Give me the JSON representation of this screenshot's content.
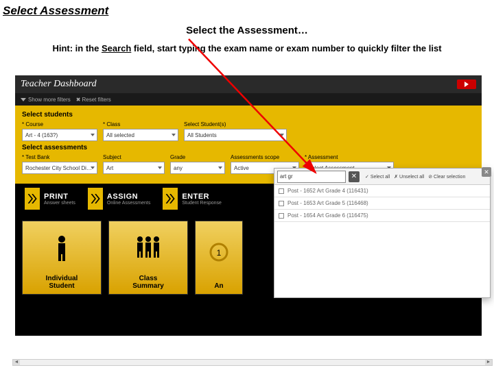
{
  "doc": {
    "title": "Select Assessment",
    "subtitle": "Select the Assessment…",
    "hint_pre": "Hint: in the ",
    "hint_hl": "Search",
    "hint_post": " field, start typing the exam name or exam number to quickly filter the list"
  },
  "app": {
    "title": "Teacher Dashboard",
    "filters": {
      "show": "Show more filters",
      "reset": "Reset filters"
    }
  },
  "students": {
    "section": "Select students",
    "course_label": "* Course",
    "course_value": "Art - 4 (163?)",
    "class_label": "* Class",
    "class_value": "All selected",
    "sel_label": "Select Student(s)",
    "sel_value": "All Students"
  },
  "assess": {
    "section": "Select assessments",
    "bank_label": "* Test Bank",
    "bank_value": "Rochester City School Di…",
    "subject_label": "Subject",
    "subject_value": "Art",
    "grade_label": "Grade",
    "grade_value": "any",
    "scope_label": "Assessments scope",
    "scope_value": "Active",
    "asmt_label": "* Assessment",
    "asmt_value": "Select Assessment"
  },
  "actions": {
    "print_t": "PRINT",
    "print_s": "Answer sheets",
    "assign_t": "ASSIGN",
    "assign_s": "Online Assessments",
    "enter_t": "ENTER",
    "enter_s": "Student Response"
  },
  "tiles": {
    "t1": "Individual\nStudent",
    "t2": "Class\nSummary",
    "t3": "An",
    "t4": ""
  },
  "popup": {
    "search": "art gr",
    "selectall": "Select all",
    "unselect": "Unselect all",
    "clear": "Clear selection",
    "items": [
      "Post - 1652 Art Grade 4 (116431)",
      "Post - 1653 Art Grade 5 (116468)",
      "Post - 1654 Art Grade 6 (116475)"
    ]
  }
}
